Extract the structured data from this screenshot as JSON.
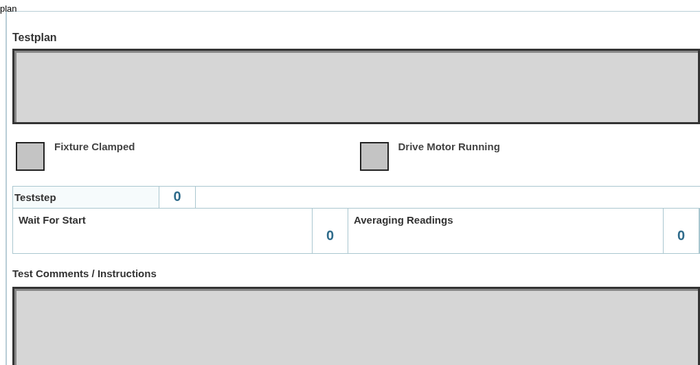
{
  "top_caption": "plan",
  "testplan": {
    "label": "Testplan"
  },
  "indicators": [
    {
      "label": "Fixture Clamped",
      "on": false
    },
    {
      "label": "Drive Motor Running",
      "on": false
    }
  ],
  "teststep": {
    "label": "Teststep",
    "value": "0"
  },
  "steps": [
    {
      "label": "Wait For Start",
      "value": "0"
    },
    {
      "label": "Averaging Readings",
      "value": "0"
    }
  ],
  "comments": {
    "label": "Test Comments / Instructions"
  }
}
